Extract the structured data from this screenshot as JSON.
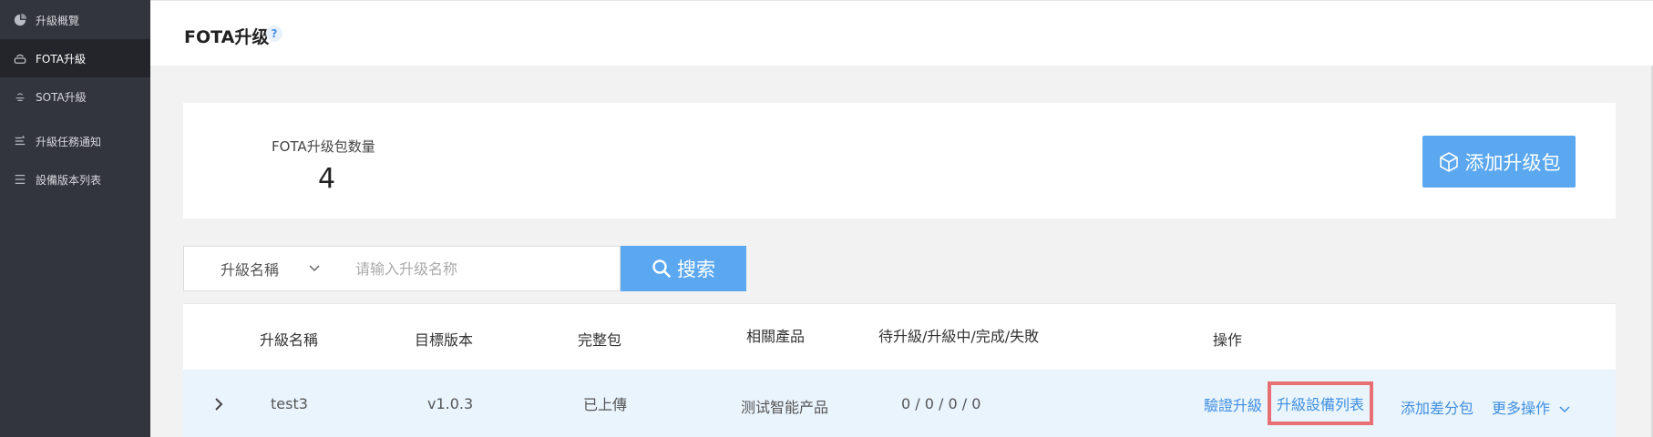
{
  "sidebar": {
    "items": [
      {
        "label": "升級概覽",
        "icon": "pie-chart-icon"
      },
      {
        "label": "FOTA升級",
        "icon": "router-icon"
      },
      {
        "label": "SOTA升級",
        "icon": "sota-icon"
      },
      {
        "label": "升級任務通知",
        "icon": "task-icon"
      },
      {
        "label": "設備版本列表",
        "icon": "list-icon"
      }
    ]
  },
  "header": {
    "title": "FOTA升级",
    "help": "?"
  },
  "summary": {
    "count_label": "FOTA升级包数量",
    "count_value": "4",
    "add_button": "添加升级包"
  },
  "search": {
    "select_value": "升級名稱",
    "placeholder": "请输入升级名称",
    "button": "搜索"
  },
  "table": {
    "headers": [
      "升級名稱",
      "目標版本",
      "完整包",
      "相關產品",
      "待升級/升級中/完成/失敗",
      "操作"
    ],
    "rows": [
      {
        "name": "test3",
        "version": "v1.0.3",
        "package": "已上傳",
        "product": "测试智能产品",
        "status": "0 / 0 / 0 / 0",
        "actions": {
          "verify": "驗證升級",
          "device_list": "升級設備列表",
          "add_diff": "添加差分包",
          "more": "更多操作"
        }
      }
    ]
  }
}
